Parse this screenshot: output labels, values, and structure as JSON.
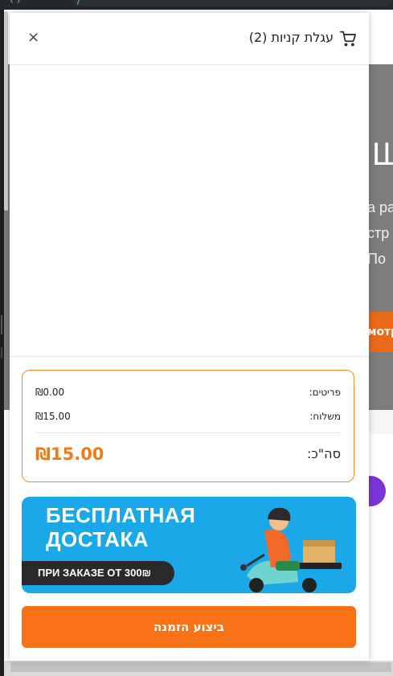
{
  "browser": {
    "nav": "‹ ›",
    "url": "/"
  },
  "background_page": {
    "hero_title": "Ш",
    "hero_lines": [
      "а ра",
      "стр",
      "По"
    ],
    "hero_button": "мотр"
  },
  "cart": {
    "title": "עגלת קניות (2)",
    "close_label": "×",
    "icons": {
      "cart": "shopping-cart-icon",
      "close": "close-icon"
    },
    "summary": {
      "items_label": "פריטים:",
      "items_value": "₪0.00",
      "shipping_label": "משלוח:",
      "shipping_value": "₪15.00",
      "total_label": "סה\"כ:",
      "total_value": "₪15.00"
    },
    "banner": {
      "line1": "БЕСПЛАТНАЯ",
      "line2": "ДОСТАКА",
      "line3": "ПРИ ЗАКАЗЕ ОТ 300₪"
    },
    "order_button": "ביצוע הזמנה"
  },
  "colors": {
    "accent": "#f97316",
    "total": "#f07a17",
    "banner": "#1aa8e8",
    "summary_border": "#f08a2a"
  }
}
